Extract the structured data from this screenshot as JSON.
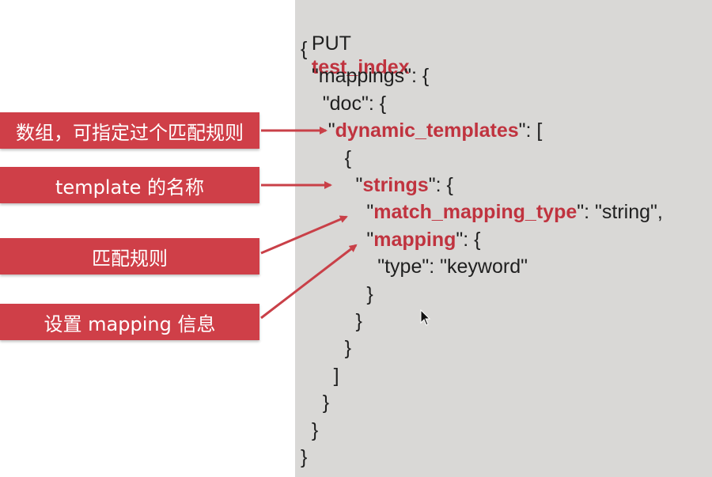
{
  "code": {
    "put_keyword": "PUT",
    "index_name": "test_index",
    "lines": [
      {
        "prefix": "{",
        "kw": "",
        "suffix": ""
      },
      {
        "prefix": "  \"mappings\": {",
        "kw": "",
        "suffix": ""
      },
      {
        "prefix": "    \"doc\": {",
        "kw": "",
        "suffix": ""
      },
      {
        "prefix": "     \"",
        "kw": "dynamic_templates",
        "suffix": "\": ["
      },
      {
        "prefix": "        {",
        "kw": "",
        "suffix": ""
      },
      {
        "prefix": "          \"",
        "kw": "strings",
        "suffix": "\": {"
      },
      {
        "prefix": "            \"",
        "kw": "match_mapping_type",
        "suffix": "\": \"string\","
      },
      {
        "prefix": "            \"",
        "kw": "mapping",
        "suffix": "\": {"
      },
      {
        "prefix": "              \"type\": \"keyword\"",
        "kw": "",
        "suffix": ""
      },
      {
        "prefix": "            }",
        "kw": "",
        "suffix": ""
      },
      {
        "prefix": "          }",
        "kw": "",
        "suffix": ""
      },
      {
        "prefix": "        }",
        "kw": "",
        "suffix": ""
      },
      {
        "prefix": "      ]",
        "kw": "",
        "suffix": ""
      },
      {
        "prefix": "    }",
        "kw": "",
        "suffix": ""
      },
      {
        "prefix": "  }",
        "kw": "",
        "suffix": ""
      },
      {
        "prefix": "}",
        "kw": "",
        "suffix": ""
      }
    ]
  },
  "annotations": [
    {
      "text": "数组，可指定过个匹配规则"
    },
    {
      "text": "template 的名称"
    },
    {
      "text": "匹配规则"
    },
    {
      "text": "设置 mapping 信息"
    }
  ],
  "colors": {
    "label_bg": "#cf3f48",
    "keyword": "#c0333f",
    "panel_bg": "#d9d8d6",
    "arrow": "#c94048"
  },
  "icons": [
    "mouse-cursor-icon"
  ]
}
